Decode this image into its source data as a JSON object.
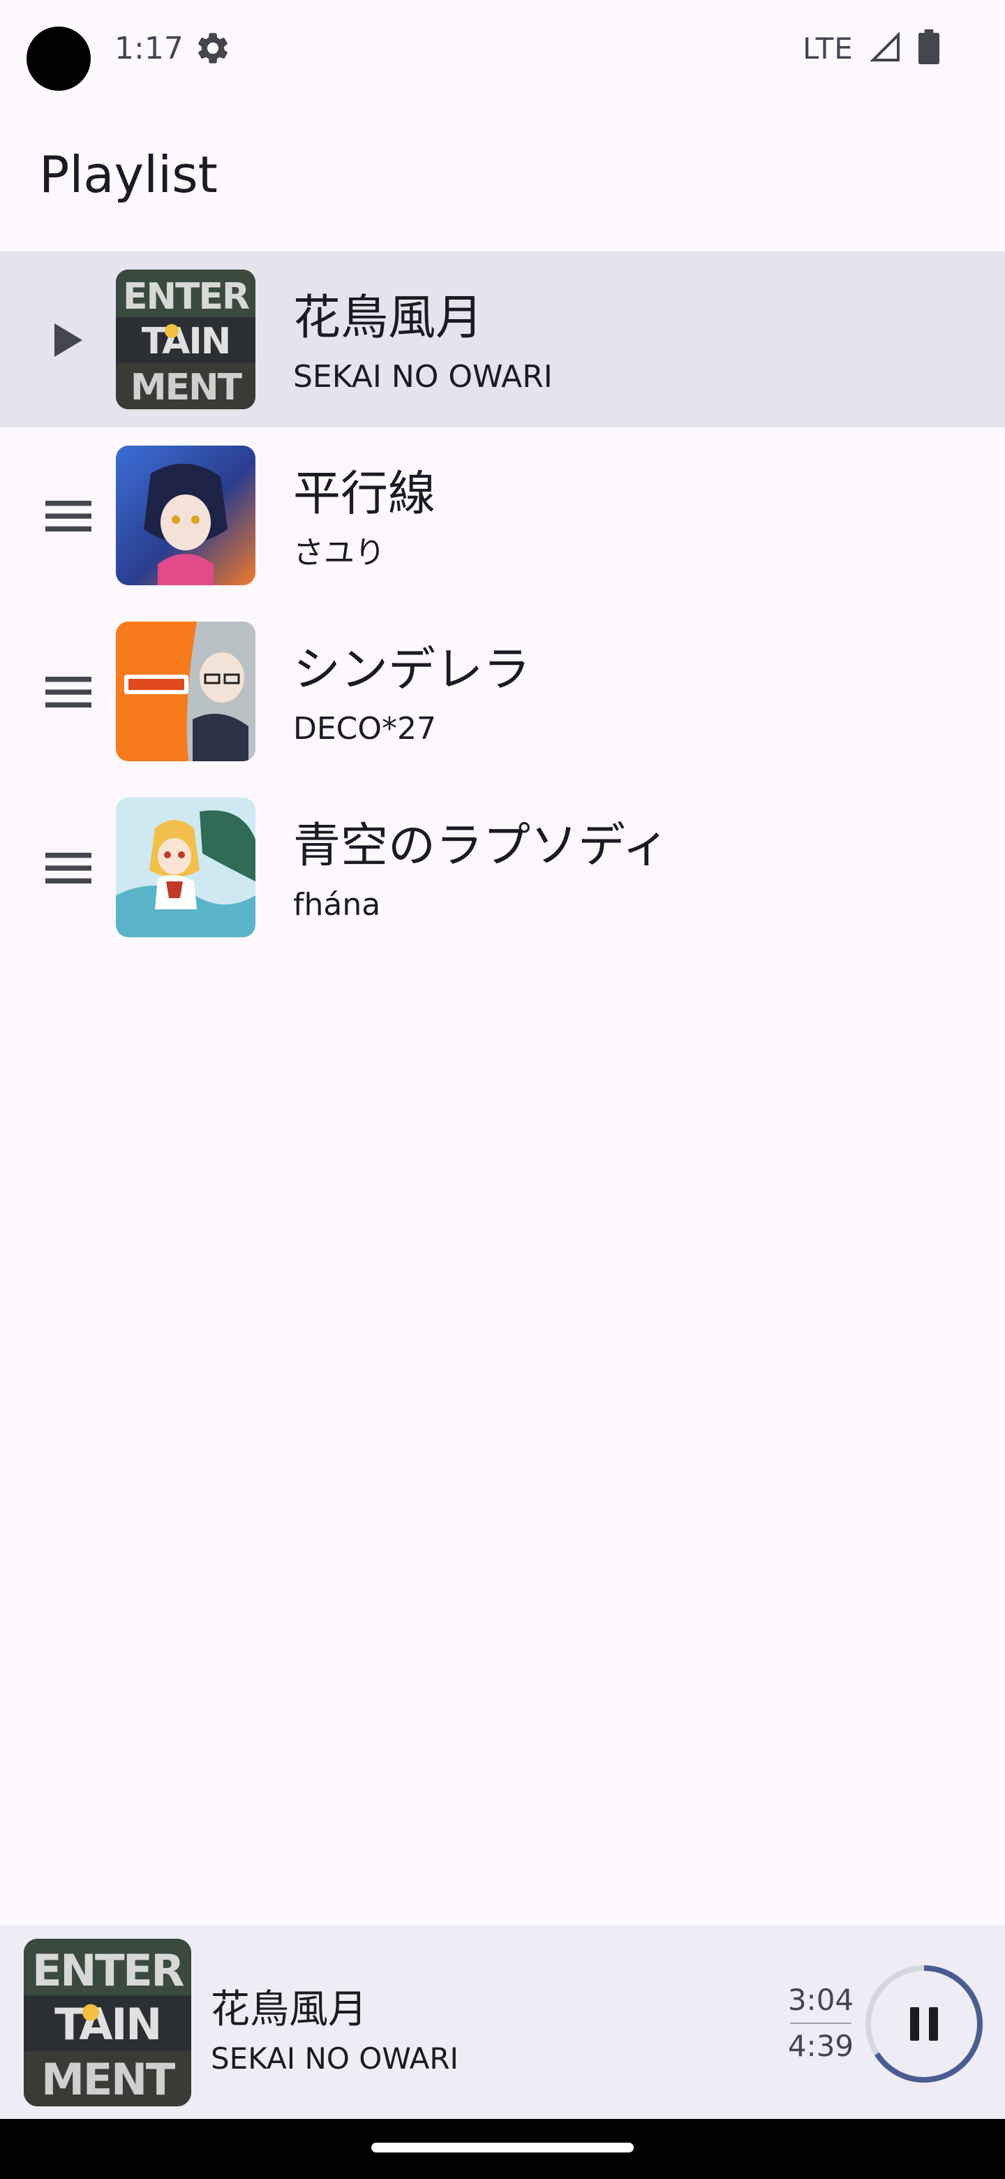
{
  "status_bar": {
    "time": "1:17",
    "network": "LTE",
    "icons": [
      "settings-gear-icon",
      "cell-signal-icon",
      "battery-icon"
    ]
  },
  "header": {
    "title": "Playlist"
  },
  "playlist": {
    "items": [
      {
        "title": "花鳥風月",
        "artist": "SEKAI NO OWARI",
        "state": "playing",
        "handle_icon": "play-arrow-icon",
        "art_icon": "album-art-entertainment"
      },
      {
        "title": "平行線",
        "artist": "さユり",
        "state": "queued",
        "handle_icon": "drag-handle-icon",
        "art_icon": "album-art-anime-girl"
      },
      {
        "title": "シンデレラ",
        "artist": "DECO*27",
        "state": "queued",
        "handle_icon": "drag-handle-icon",
        "art_icon": "album-art-cinderella"
      },
      {
        "title": "青空のラプソディ",
        "artist": "fhána",
        "state": "queued",
        "handle_icon": "drag-handle-icon",
        "art_icon": "album-art-maid-dragon"
      }
    ]
  },
  "now_playing": {
    "title": "花鳥風月",
    "artist": "SEKAI NO OWARI",
    "current_time": "3:04",
    "total_time": "4:39",
    "progress_fraction": 0.66,
    "control_icon": "pause-icon"
  },
  "colors": {
    "background": "#fcf8fe",
    "active_row": "#e4e3ee",
    "mini_player": "#eeecf5",
    "accent": "#4a5c92",
    "track": "#d6d6de"
  }
}
